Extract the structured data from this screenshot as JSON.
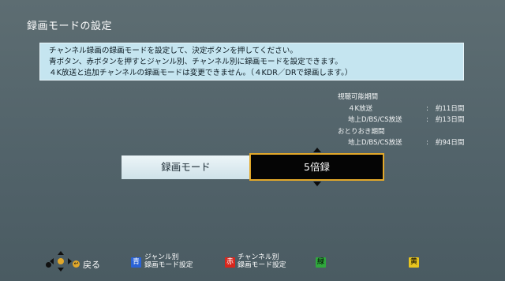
{
  "title": "録画モードの設定",
  "message": {
    "line1": "チャンネル録画の録画モードを設定して、決定ボタンを押してください。",
    "line2": "青ボタン、赤ボタンを押すとジャンル別、チャンネル別に録画モードを設定できます。",
    "line3": "４K放送と追加チャンネルの録画モードは変更できません。（４KDR／DRで録画します。）"
  },
  "info": {
    "viewable_header": "視聴可能期間",
    "viewable_rows": [
      {
        "label": "４K放送",
        "colon": ":",
        "value": "約11日間"
      },
      {
        "label": "地上D/BS/CS放送",
        "colon": ":",
        "value": "約13日間"
      }
    ],
    "keep_header": "おとりおき期間",
    "keep_rows": [
      {
        "label": "地上D/BS/CS放送",
        "colon": ":",
        "value": "約94日間"
      }
    ]
  },
  "mode": {
    "label": "録画モード",
    "value": "5倍録"
  },
  "footer": {
    "back": "戻る",
    "blue_key": "青",
    "blue_line1": "ジャンル別",
    "blue_line2": "録画モード設定",
    "red_key": "赤",
    "red_line1": "チャンネル別",
    "red_line2": "録画モード設定",
    "green_key": "緑",
    "yellow_key": "黄"
  },
  "colors": {
    "accent": "#e2a82a",
    "blue": "#2b63d6",
    "red": "#d8261c",
    "green": "#2fa83c",
    "yellow": "#e8c51e"
  }
}
